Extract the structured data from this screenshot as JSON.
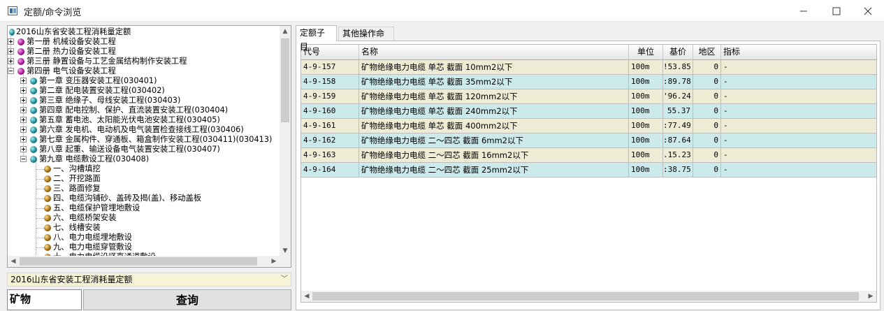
{
  "window": {
    "title": "定额/命令浏览",
    "icon": "app-window-icon"
  },
  "tree": {
    "root": "2016山东省安装工程消耗量定额",
    "volumes": [
      {
        "label": "第一册 机械设备安装工程",
        "expanded": false
      },
      {
        "label": "第二册 热力设备安装工程",
        "expanded": false
      },
      {
        "label": "第三册 静置设备与工艺金属结构制作安装工程",
        "expanded": false
      },
      {
        "label": "第四册 电气设备安装工程",
        "expanded": true
      }
    ],
    "chapters": [
      {
        "label": "第一章 变压器安装工程(030401)",
        "expanded": false
      },
      {
        "label": "第二章 配电装置安装工程(030402)",
        "expanded": false
      },
      {
        "label": "第三章 绝缘子、母线安装工程(030403)",
        "expanded": false
      },
      {
        "label": "第四章 配电控制、保护、直流装置安装工程(030404)",
        "expanded": false
      },
      {
        "label": "第五章 蓄电池、太阳能光伏电池安装工程(030405)",
        "expanded": false
      },
      {
        "label": "第六章 发电机、电动机及电气装置检查接线工程(030406)",
        "expanded": false
      },
      {
        "label": "第七章 金属构件、穿通板、箱盒制作安装工程(030411)(030413)",
        "expanded": false
      },
      {
        "label": "第八章 起重、输送设备电气装置安装工程(030407)",
        "expanded": false
      },
      {
        "label": "第九章 电缆敷设工程(030408)",
        "expanded": true
      }
    ],
    "sections": [
      "一、沟槽填挖",
      "二、开挖路面",
      "三、路面修复",
      "四、电缆沟铺砂、盖砖及揭(盖)、移动盖板",
      "五、电缆保护管埋地敷设",
      "六、电缆桥架安装",
      "七、线槽安装",
      "八、电力电缆埋地敷设",
      "九、电力电缆穿管敷设",
      "十、电力电缆沿竖直通道敷设"
    ]
  },
  "library_combo": {
    "value": "2016山东省安装工程消耗量定额"
  },
  "search": {
    "value": "矿物",
    "button_label": "查询"
  },
  "tabs": [
    {
      "label": "定额子目",
      "active": true
    },
    {
      "label": "其他操作命令",
      "active": false
    }
  ],
  "grid": {
    "columns": [
      "代号",
      "名称",
      "单位",
      "基价",
      "地区",
      "指标"
    ],
    "rows": [
      {
        "code": "4-9-157",
        "name": "矿物绝缘电力电缆  单芯 截面 10mm2以下",
        "unit": "100m",
        "price": "!53.85",
        "region": "0",
        "index": "-"
      },
      {
        "code": "4-9-158",
        "name": "矿物绝缘电力电缆  单芯 截面 35mm2以下",
        "unit": "100m",
        "price": ":89.78",
        "region": "0",
        "index": "-"
      },
      {
        "code": "4-9-159",
        "name": "矿物绝缘电力电缆  单芯 截面 120mm2以下",
        "unit": "100m",
        "price": "'96.24",
        "region": "0",
        "index": "-"
      },
      {
        "code": "4-9-160",
        "name": "矿物绝缘电力电缆  单芯 截面 240mm2以下",
        "unit": "100m",
        "price": "55.37",
        "region": "0",
        "index": "-"
      },
      {
        "code": "4-9-161",
        "name": "矿物绝缘电力电缆  单芯 截面 400mm2以下",
        "unit": "100m",
        "price": ":77.49",
        "region": "0",
        "index": "-"
      },
      {
        "code": "4-9-162",
        "name": "矿物绝缘电力电缆  二～四芯 截面 6mm2以下",
        "unit": "100m",
        "price": ":87.64",
        "region": "0",
        "index": "-"
      },
      {
        "code": "4-9-163",
        "name": "矿物绝缘电力电缆  二～四芯 截面 16mm2以下",
        "unit": "100m",
        "price": ".15.23",
        "region": "0",
        "index": "-"
      },
      {
        "code": "4-9-164",
        "name": "矿物绝缘电力电缆  二～四芯 截面 25mm2以下",
        "unit": "100m",
        "price": ":38.75",
        "region": "0",
        "index": "-"
      }
    ]
  },
  "colors": {
    "row_odd": "#eeecd4",
    "row_even": "#cce9eb",
    "combo_bg": "#f7f3d7"
  }
}
